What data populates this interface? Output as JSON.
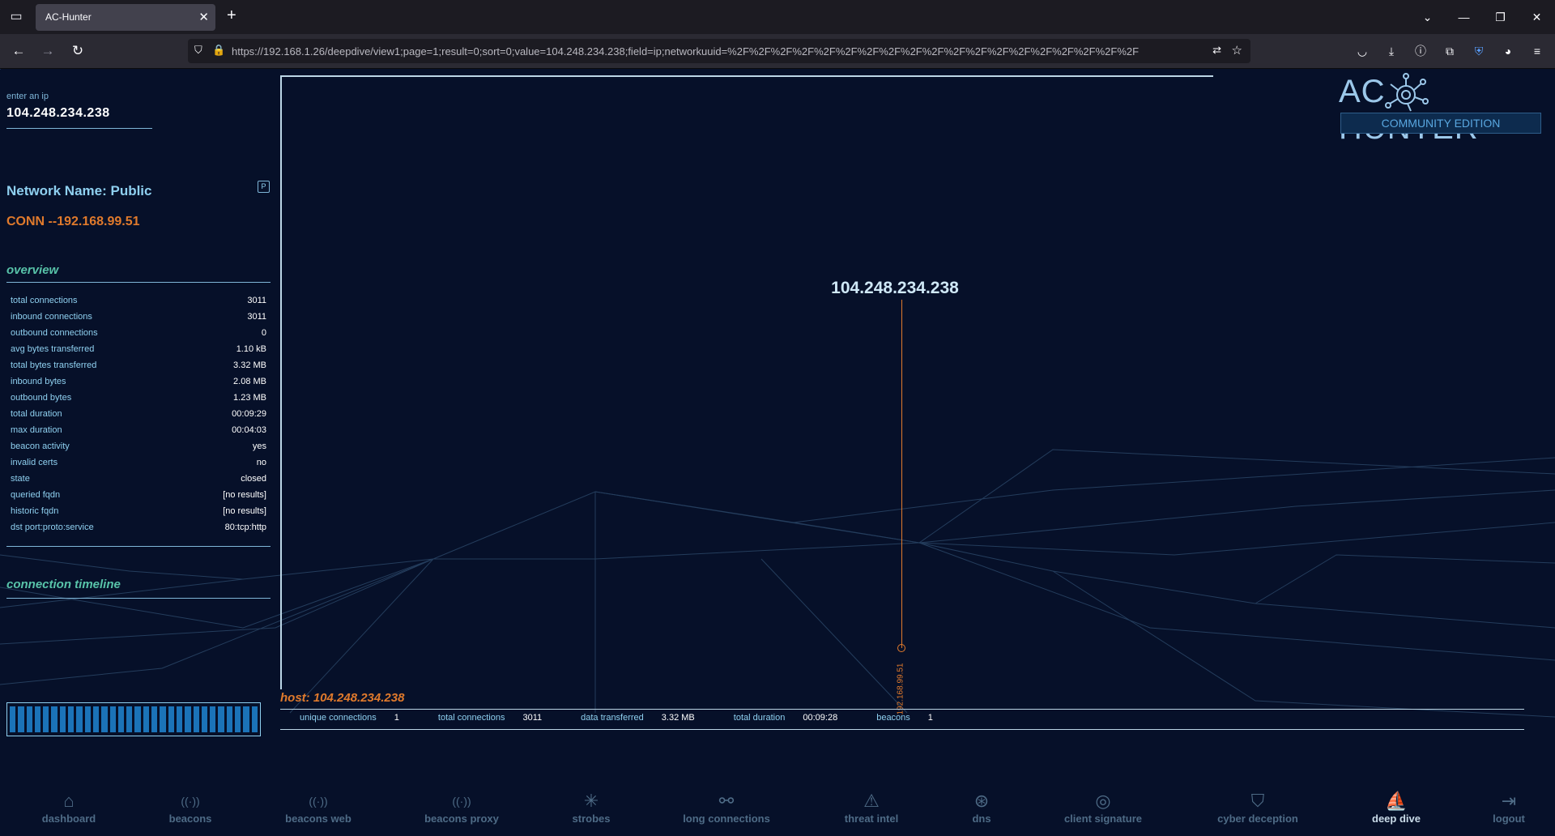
{
  "browser": {
    "tab_title": "AC-Hunter",
    "url": "https://192.168.1.26/deepdive/view1;page=1;result=0;sort=0;value=104.248.234.238;field=ip;networkuuid=%2F%2F%2F%2F%2F%2F%2F%2F%2F%2F%2F%2F%2F%2F%2F%2F%2F%2F%2F"
  },
  "sidebar": {
    "ip_label": "enter an ip",
    "ip_value": "104.248.234.238",
    "network_name": "Network Name: Public",
    "network_badge": "P",
    "conn_label": "CONN --192.168.99.51",
    "overview_title": "overview",
    "overview": [
      {
        "label": "total connections",
        "value": "3011"
      },
      {
        "label": "inbound connections",
        "value": "3011"
      },
      {
        "label": "outbound connections",
        "value": "0"
      },
      {
        "label": "avg bytes transferred",
        "value": "1.10 kB"
      },
      {
        "label": "total bytes transferred",
        "value": "3.32 MB"
      },
      {
        "label": "inbound bytes",
        "value": "2.08 MB"
      },
      {
        "label": "outbound bytes",
        "value": "1.23 MB"
      },
      {
        "label": "total duration",
        "value": "00:09:29"
      },
      {
        "label": "max duration",
        "value": "00:04:03"
      },
      {
        "label": "beacon activity",
        "value": "yes"
      },
      {
        "label": "invalid certs",
        "value": "no"
      },
      {
        "label": "state",
        "value": "closed"
      },
      {
        "label": "queried fqdn",
        "value": "[no results]"
      },
      {
        "label": "historic fqdn",
        "value": "[no results]"
      },
      {
        "label": "dst port:proto:service",
        "value": "80:tcp:http"
      }
    ],
    "timeline_title": "connection timeline"
  },
  "graph": {
    "center_ip": "104.248.234.238",
    "node_label": "192.168.99.51"
  },
  "host": {
    "label": "host: 104.248.234.238",
    "stats": [
      {
        "label": "unique connections",
        "value": "1"
      },
      {
        "label": "total connections",
        "value": "3011"
      },
      {
        "label": "data transferred",
        "value": "3.32 MB"
      },
      {
        "label": "total duration",
        "value": "00:09:28"
      },
      {
        "label": "beacons",
        "value": "1"
      }
    ]
  },
  "logo": {
    "left": "AC",
    "right": "HUNTER",
    "edition": "COMMUNITY EDITION"
  },
  "nav": [
    {
      "label": "dashboard",
      "icon": "home-icon"
    },
    {
      "label": "beacons",
      "icon": "antenna-icon"
    },
    {
      "label": "beacons web",
      "icon": "antenna-icon"
    },
    {
      "label": "beacons proxy",
      "icon": "antenna-icon"
    },
    {
      "label": "strobes",
      "icon": "burst-icon"
    },
    {
      "label": "long connections",
      "icon": "graph-icon"
    },
    {
      "label": "threat intel",
      "icon": "warning-icon"
    },
    {
      "label": "dns",
      "icon": "globe-icon"
    },
    {
      "label": "client signature",
      "icon": "fingerprint-icon"
    },
    {
      "label": "cyber deception",
      "icon": "shield-icon"
    },
    {
      "label": "deep dive",
      "icon": "diver-icon",
      "active": true
    },
    {
      "label": "logout",
      "icon": "logout-icon"
    }
  ],
  "colors": {
    "accent_orange": "#e07a2c",
    "accent_cyan": "#8fd0f0",
    "section_green": "#58c3a9",
    "background": "#061029"
  }
}
